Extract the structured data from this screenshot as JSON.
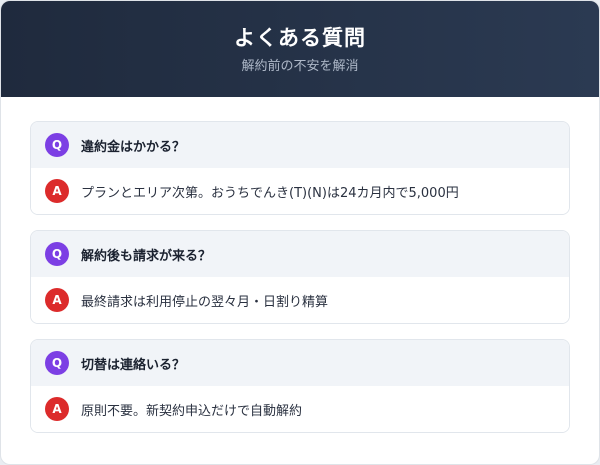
{
  "header": {
    "title": "よくある質問",
    "subtitle": "解約前の不安を解消"
  },
  "colors": {
    "header_start": "#1f2a3d",
    "header_end": "#2b3a52",
    "q_badge": "#7c3fe4",
    "a_badge": "#dc2b2b"
  },
  "faq": [
    {
      "q_badge": "Q",
      "question": "違約金はかかる？",
      "a_badge": "A",
      "answer": "プランとエリア次第。おうちでんき(T)(N)は24カ月内で5,000円"
    },
    {
      "q_badge": "Q",
      "question": "解約後も請求が来る？",
      "a_badge": "A",
      "answer": "最終請求は利用停止の翌々月・日割り精算"
    },
    {
      "q_badge": "Q",
      "question": "切替は連絡いる？",
      "a_badge": "A",
      "answer": "原則不要。新契約申込だけで自動解約"
    }
  ]
}
